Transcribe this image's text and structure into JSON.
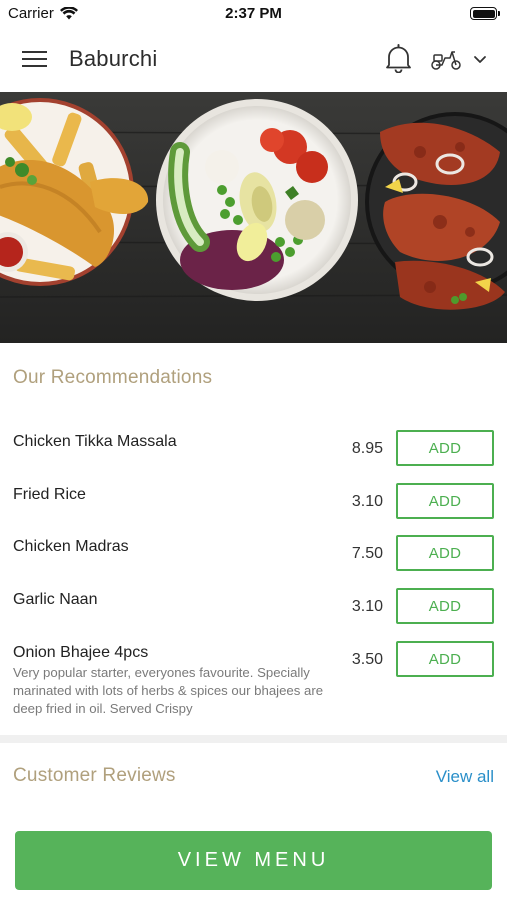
{
  "status_bar": {
    "carrier": "Carrier",
    "time": "2:37 PM",
    "icons": [
      "wifi-icon",
      "battery-icon"
    ]
  },
  "header": {
    "title": "Baburchi",
    "icons": [
      "menu-icon",
      "bell-icon",
      "scooter-icon",
      "chevron-down-icon"
    ]
  },
  "hero": {
    "dishes_depicted": [
      "fish-and-chips",
      "salad-bowl",
      "tandoori-chicken"
    ]
  },
  "recommendations": {
    "title": "Our Recommendations",
    "items": [
      {
        "name": "Chicken Tikka Massala",
        "description": "",
        "price": "8.95",
        "button": "ADD"
      },
      {
        "name": "Fried Rice",
        "description": "",
        "price": "3.10",
        "button": "ADD"
      },
      {
        "name": "Chicken Madras",
        "description": "",
        "price": "7.50",
        "button": "ADD"
      },
      {
        "name": "Garlic Naan",
        "description": "",
        "price": "3.10",
        "button": "ADD"
      },
      {
        "name": "Onion Bhajee 4pcs",
        "description": "Very popular starter, everyones favourite. Specially marinated with lots of herbs & spices our bhajees are deep fried in oil. Served Crispy",
        "price": "3.50",
        "button": "ADD"
      }
    ]
  },
  "reviews": {
    "title": "Customer Reviews",
    "view_all": "View all"
  },
  "footer": {
    "button": "VIEW MENU"
  },
  "colors": {
    "accent_green": "#4caf50",
    "button_green": "#56b35a",
    "section_title": "#b0a07d",
    "link_blue": "#2a8fc9"
  }
}
